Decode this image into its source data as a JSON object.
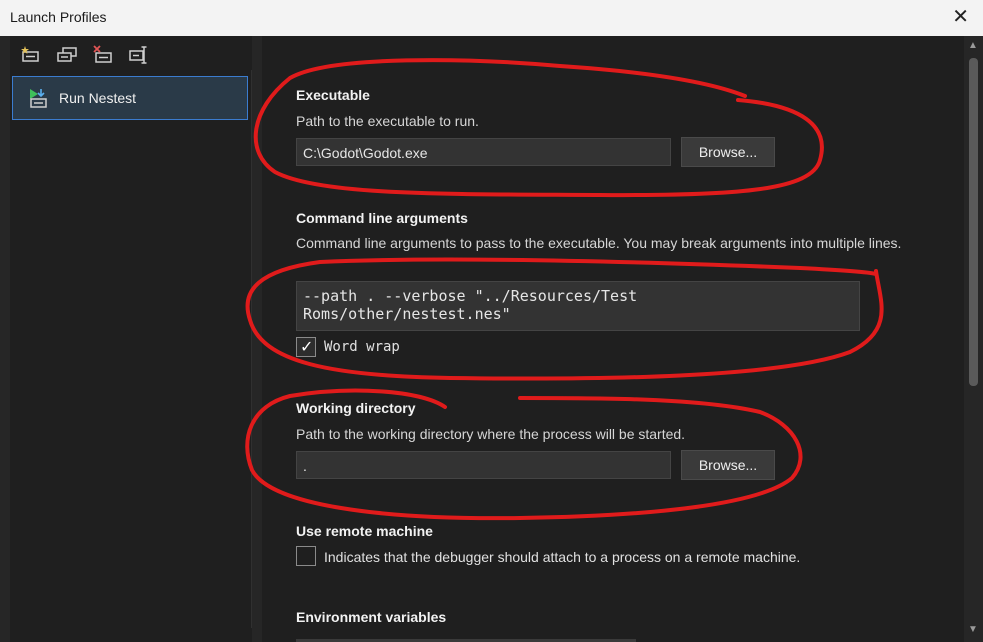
{
  "window": {
    "title": "Launch Profiles",
    "close_glyph": "✕"
  },
  "toolbar": {
    "icons": [
      "new-profile-icon",
      "duplicate-profile-icon",
      "delete-profile-icon",
      "rename-profile-icon"
    ]
  },
  "profiles": [
    {
      "label": "Run Nestest",
      "icon": "run-profile-icon",
      "selected": true
    }
  ],
  "executable": {
    "title": "Executable",
    "description": "Path to the executable to run.",
    "value": "C:\\Godot\\Godot.exe",
    "browse_label": "Browse..."
  },
  "arguments": {
    "title": "Command line arguments",
    "description": "Command line arguments to pass to the executable. You may break arguments into multiple lines.",
    "value": "--path . --verbose \"../Resources/Test Roms/other/nestest.nes\"",
    "word_wrap_label": "Word wrap",
    "word_wrap_checked": true
  },
  "working_directory": {
    "title": "Working directory",
    "description": "Path to the working directory where the process will be started.",
    "value": ".",
    "browse_label": "Browse..."
  },
  "remote": {
    "title": "Use remote machine",
    "description": "Indicates that the debugger should attach to a process on a remote machine.",
    "checked": false
  },
  "environment": {
    "title": "Environment variables"
  },
  "colors": {
    "background": "#1f1f1f",
    "accent": "#3b7ccf",
    "annotation": "#e01b1b"
  }
}
